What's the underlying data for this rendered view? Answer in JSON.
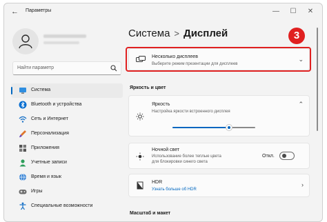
{
  "window": {
    "title": "Параметры"
  },
  "sidebar": {
    "search_placeholder": "Найти параметр",
    "items": [
      {
        "label": "Система",
        "icon": "system-icon",
        "active": true
      },
      {
        "label": "Bluetooth и устройства",
        "icon": "bluetooth-icon"
      },
      {
        "label": "Сеть и Интернет",
        "icon": "wifi-icon"
      },
      {
        "label": "Персонализация",
        "icon": "brush-icon"
      },
      {
        "label": "Приложения",
        "icon": "apps-icon"
      },
      {
        "label": "Учетные записи",
        "icon": "account-icon"
      },
      {
        "label": "Время и язык",
        "icon": "globe-icon"
      },
      {
        "label": "Игры",
        "icon": "gamepad-icon"
      },
      {
        "label": "Специальные возможности",
        "icon": "accessibility-icon"
      }
    ]
  },
  "main": {
    "breadcrumb_parent": "Система",
    "breadcrumb_sep": ">",
    "breadcrumb_current": "Дисплей",
    "step_badge": "3",
    "multi_display": {
      "title": "Несколько дисплеев",
      "desc": "Выберите режим презентации для дисплеев"
    },
    "brightness_section": "Яркость и цвет",
    "brightness": {
      "title": "Яркость",
      "desc": "Настройка яркости встроенного дисплея",
      "level_percent": 68
    },
    "night_light": {
      "title": "Ночной свет",
      "desc_line1": "Использование более теплые цвета",
      "desc_line2": "для блокировки синего света",
      "toggle_label": "Откл.",
      "enabled": false
    },
    "hdr": {
      "title": "HDR",
      "desc": "Узнать больше об HDR"
    },
    "scale_section": "Масштаб и макет"
  },
  "colors": {
    "accent": "#0067c0",
    "highlight": "#e02020"
  }
}
